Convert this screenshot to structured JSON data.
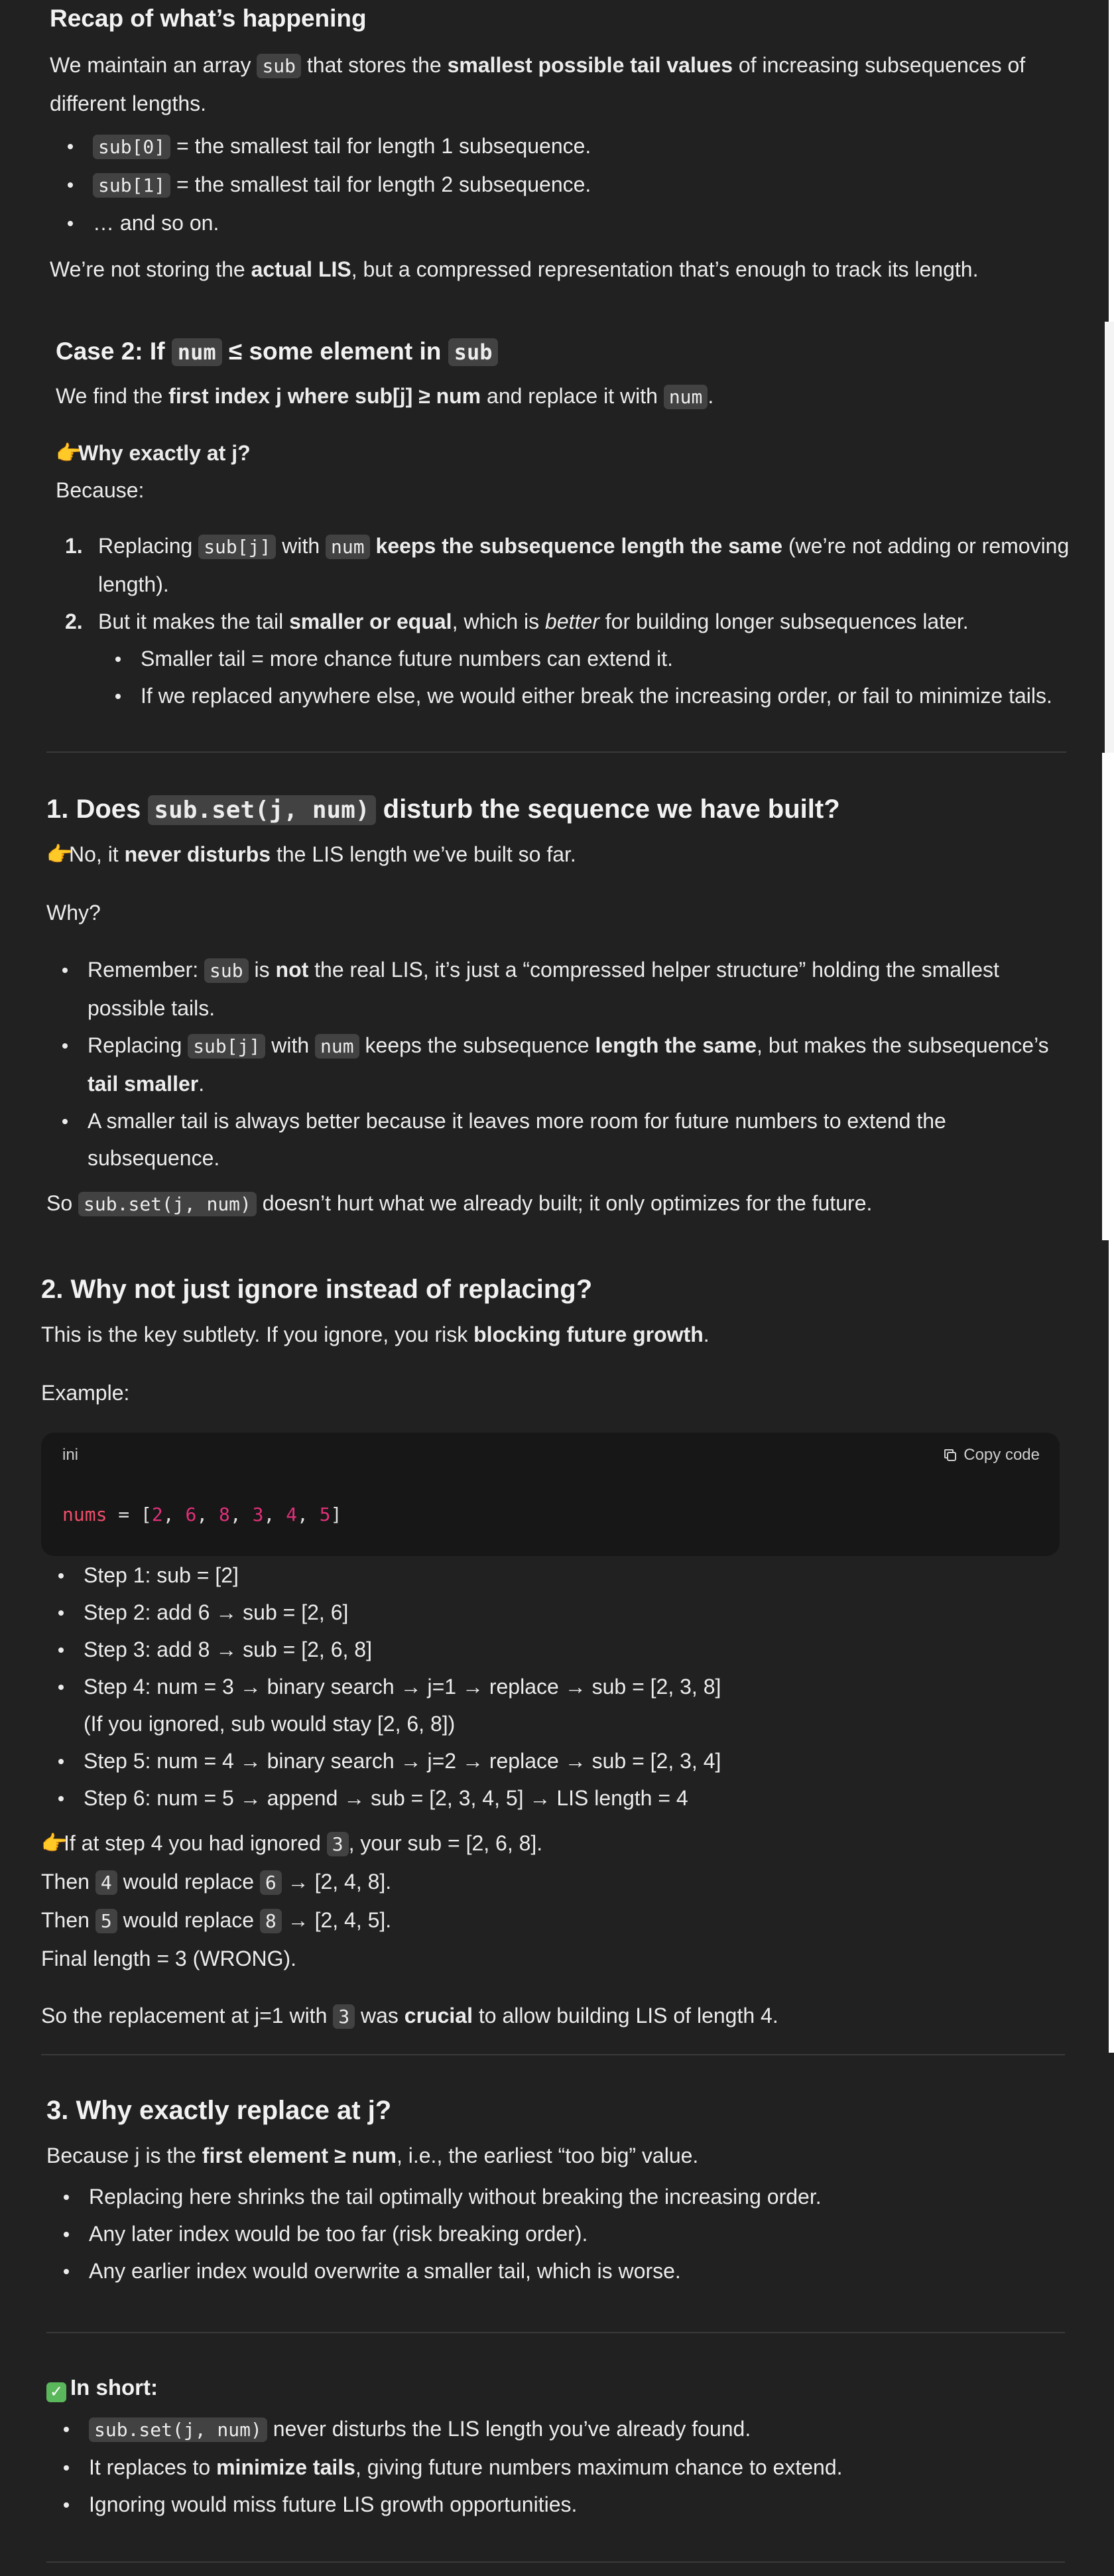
{
  "recap": {
    "title": "Recap of what’s happening",
    "p1": {
      "a": "We maintain an array ",
      "code": "sub",
      "b": " that stores the ",
      "bold": "smallest possible tail values",
      "c": " of increasing subsequences of different lengths."
    },
    "items": [
      {
        "code": "sub[0]",
        "text": " = the smallest tail for length 1 subsequence."
      },
      {
        "code": "sub[1]",
        "text": " = the smallest tail for length 2 subsequence."
      },
      {
        "text": "… and so on."
      }
    ],
    "p2": {
      "a": "We’re not storing the ",
      "bold": "actual LIS",
      "b": ", but a compressed representation that’s enough to track its length."
    }
  },
  "case2": {
    "title_a": "Case 2: If ",
    "title_code1": "num",
    "title_b": " ≤ some element in ",
    "title_code2": "sub",
    "p1": {
      "a": "We find the ",
      "bold": "first index j where sub[j] ≥ num",
      "b": " and replace it with ",
      "code": "num",
      "c": "."
    },
    "why_title": "Why exactly at j?",
    "because": "Because:",
    "ol": [
      {
        "n": "1.",
        "a": "Replacing ",
        "code1": "sub[j]",
        "b": " with ",
        "code2": "num",
        "c": " ",
        "bold": "keeps the subsequence length the same",
        "d": " (we’re not adding or removing length)."
      },
      {
        "n": "2.",
        "a": "But it makes the tail ",
        "bold": "smaller or equal",
        "b": ", which is ",
        "ital": "better",
        "c": " for building longer subsequences later."
      }
    ],
    "sub_items": [
      "Smaller tail = more chance future numbers can extend it.",
      "If we replaced anywhere else, we would either break the increasing order, or fail to minimize tails."
    ]
  },
  "s1": {
    "title_a": "1. Does ",
    "title_code": "sub.set(j, num)",
    "title_b": " disturb the sequence we have built?",
    "p1": {
      "a": "No, it ",
      "bold": "never disturbs",
      "b": " the LIS length we’ve built so far."
    },
    "why": "Why?",
    "items": [
      {
        "a": "Remember: ",
        "code": "sub",
        "b": " is ",
        "bold": "not",
        "c": " the real LIS, it’s just a “compressed helper structure” holding the smallest possible tails."
      },
      {
        "a": "Replacing ",
        "code1": "sub[j]",
        "b": " with ",
        "code2": "num",
        "c": " keeps the subsequence ",
        "bold1": "length the same",
        "d": ", but makes the subsequence’s ",
        "bold2": "tail smaller",
        "e": "."
      },
      {
        "a": "A smaller tail is always better because it leaves more room for future numbers to extend the subsequence."
      }
    ],
    "p2": {
      "a": "So ",
      "code": "sub.set(j, num)",
      "b": " doesn’t hurt what we already built; it only optimizes for the future."
    }
  },
  "s2": {
    "title": "2. Why not just ignore instead of replacing?",
    "p1": {
      "a": "This is the key subtlety. If you ignore, you risk ",
      "bold": "blocking future growth",
      "b": "."
    },
    "example": "Example:",
    "code": {
      "lang": "ini",
      "copy": "Copy code",
      "var": "nums",
      "eq": " = [",
      "nums": [
        "2",
        "6",
        "8",
        "3",
        "4",
        "5"
      ],
      "close": "]"
    },
    "steps": [
      "Step 1: sub = [2]",
      "Step 2: add 6 → sub = [2, 6]",
      "Step 3: add 8 → sub = [2, 6, 8]",
      "Step 4: num = 3 → binary search → j=1 → replace → sub = [2, 3, 8]",
      "Step 5: num = 4 → binary search → j=2 → replace → sub = [2, 3, 4]",
      "Step 6: num = 5 → append → sub = [2, 3, 4, 5] → LIS length = 4"
    ],
    "step4_note": "(If you ignored, sub would stay [2, 6, 8])",
    "ignored": {
      "a": "If at step 4 you had ignored ",
      "code": "3",
      "b": ", your sub = [2, 6, 8]."
    },
    "then1": {
      "a": "Then ",
      "code1": "4",
      "b": " would replace ",
      "code2": "6",
      "c": " → [2, 4, 8]."
    },
    "then2": {
      "a": "Then ",
      "code1": "5",
      "b": " would replace ",
      "code2": "8",
      "c": " → [2, 4, 5]."
    },
    "final": "Final length = 3 (WRONG).",
    "p_last": {
      "a": "So the replacement at j=1 with ",
      "code": "3",
      "b": " was ",
      "bold": "crucial",
      "c": " to allow building LIS of length 4."
    }
  },
  "s3": {
    "title": "3. Why exactly replace at j?",
    "p1": {
      "a": "Because j is the ",
      "bold": "first element ≥ num",
      "b": ", i.e., the earliest “too big” value."
    },
    "items": [
      "Replacing here shrinks the tail optimally without breaking the increasing order.",
      "Any later index would be too far (risk breaking order).",
      "Any earlier index would overwrite a smaller tail, which is worse."
    ]
  },
  "short": {
    "title": "In short:",
    "i1": {
      "code": "sub.set(j, num)",
      "text": " never disturbs the LIS length you’ve already found."
    },
    "i2": {
      "a": "It replaces to ",
      "bold": "minimize tails",
      "b": ", giving future numbers maximum chance to extend."
    },
    "i3": "Ignoring would miss future LIS growth opportunities."
  }
}
